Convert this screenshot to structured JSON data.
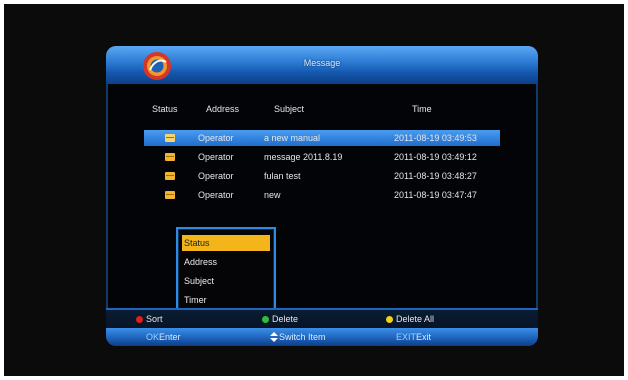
{
  "window": {
    "title": "Message"
  },
  "table": {
    "columns": [
      "Status",
      "Address",
      "Subject",
      "Time"
    ],
    "rows": [
      {
        "status_icon": "envelope-open-icon",
        "address": "Operator",
        "subject": "a new manual",
        "time": "2011-08-19 03:49:53",
        "selected": true
      },
      {
        "status_icon": "envelope-icon",
        "address": "Operator",
        "subject": "message 2011.8.19",
        "time": "2011-08-19 03:49:12",
        "selected": false
      },
      {
        "status_icon": "envelope-icon",
        "address": "Operator",
        "subject": "fulan test",
        "time": "2011-08-19 03:48:27",
        "selected": false
      },
      {
        "status_icon": "envelope-icon",
        "address": "Operator",
        "subject": "new",
        "time": "2011-08-19 03:47:47",
        "selected": false
      }
    ]
  },
  "sort_menu": {
    "items": [
      "Status",
      "Address",
      "Subject",
      "Timer"
    ],
    "active_index": 0
  },
  "footer": {
    "sort_label": "Sort",
    "delete_label": "Delete",
    "delete_all_label": "Delete All",
    "ok_key": "OK",
    "ok_label": "Enter",
    "switch_label": "Switch Item",
    "exit_key": "EXIT",
    "exit_label": "Exit"
  },
  "colors": {
    "red_key": "#e02020",
    "green_key": "#2fbf3a",
    "yellow_key": "#f0d020",
    "accent_blue": "#2a78d0",
    "highlight_orange": "#f4b51b"
  }
}
